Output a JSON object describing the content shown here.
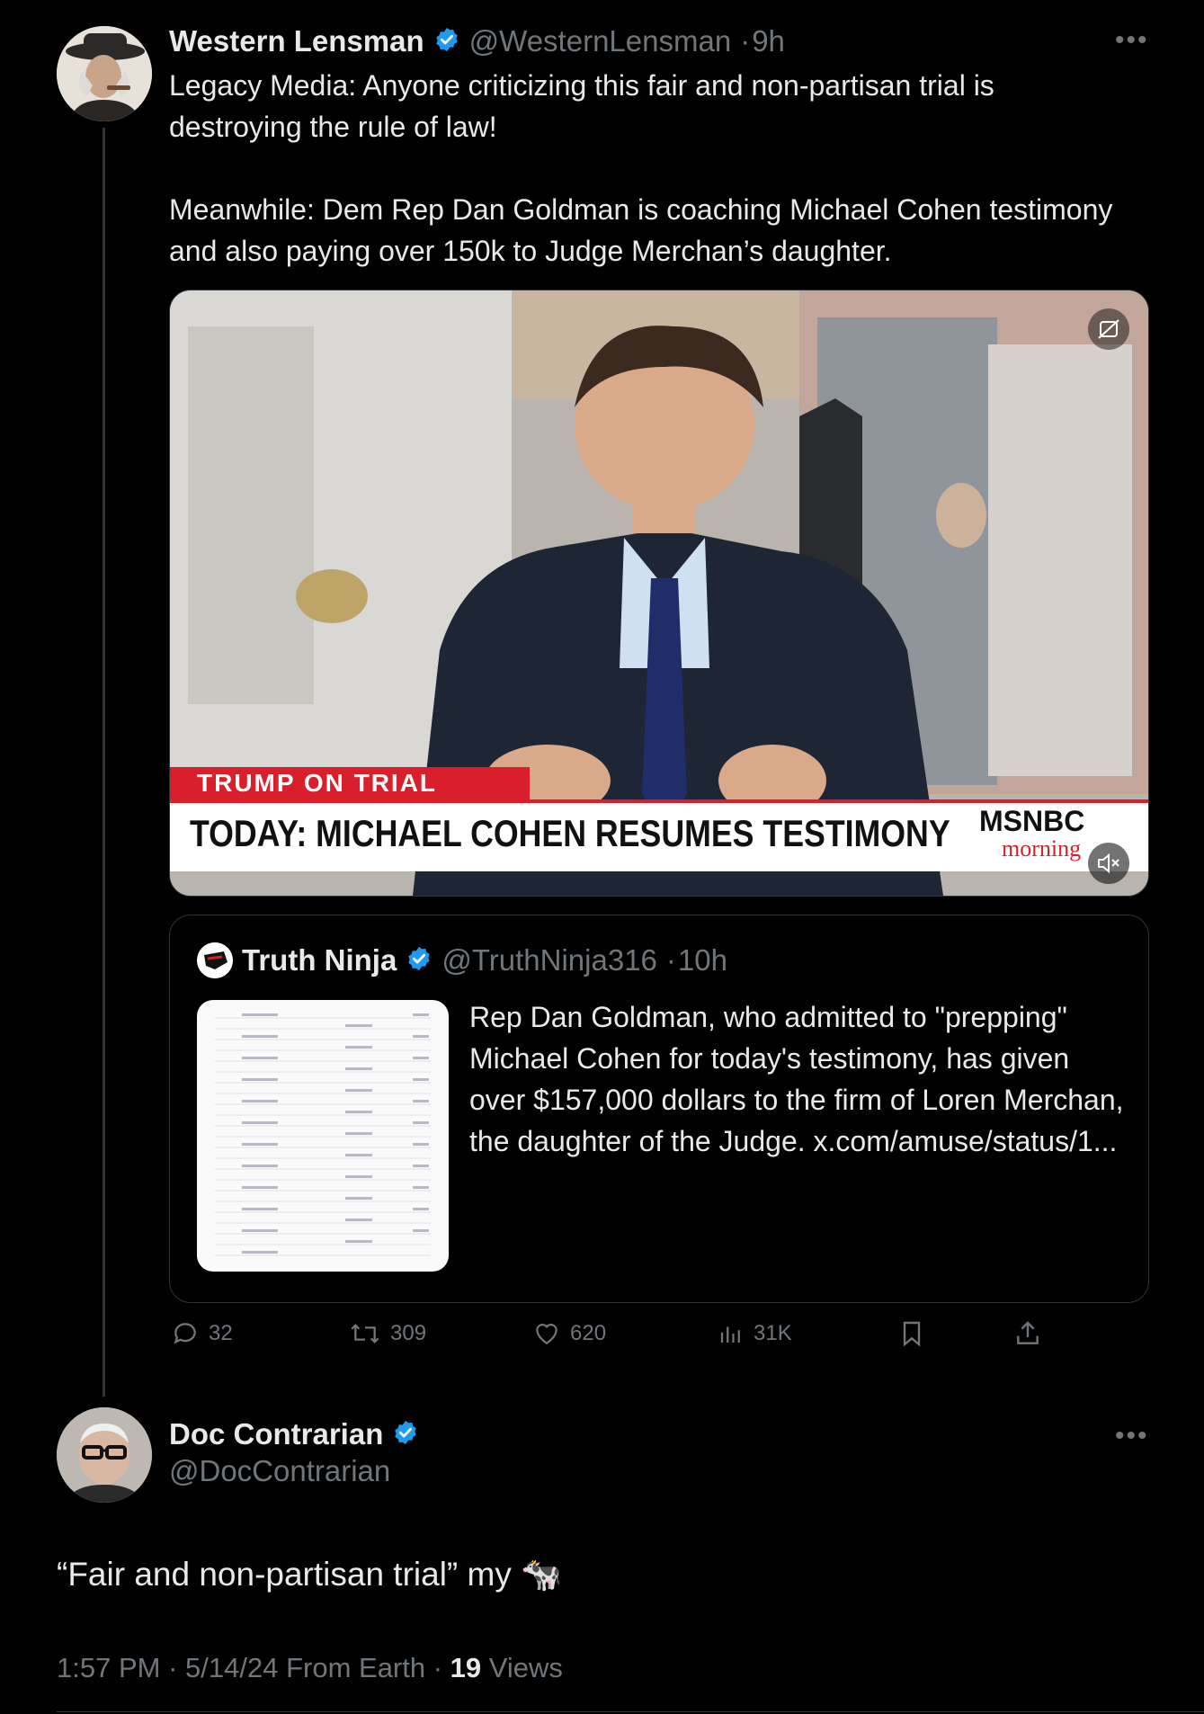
{
  "tweet": {
    "author_name": "Western Lensman",
    "handle": "@WesternLensman",
    "time": "9h",
    "text": "Legacy Media: Anyone criticizing this fair and non-partisan trial is destroying the rule of law!\n\nMeanwhile: Dem Rep Dan Goldman is coaching Michael Cohen testimony and also paying over 150k to Judge Merchan’s daughter.",
    "video": {
      "banner_tag": "TRUMP ON TRIAL",
      "headline": "TODAY: MICHAEL COHEN RESUMES TESTIMONY",
      "network": "MSNBC",
      "show": "morning"
    },
    "quote": {
      "author_name": "Truth Ninja",
      "handle": "@TruthNinja316",
      "time": "10h",
      "text": "Rep Dan Goldman, who admitted to \"prepping\" Michael Cohen for today's testimony, has given over $157,000 dollars to the firm of Loren Merchan, the daughter of the Judge. x.com/amuse/status/1..."
    },
    "actions": {
      "replies": "32",
      "reposts": "309",
      "likes": "620",
      "views": "31K"
    }
  },
  "reply": {
    "author_name": "Doc Contrarian",
    "handle": "@DocContrarian",
    "text": "“Fair and non-partisan trial” my 🐄",
    "footer": {
      "time": "1:57 PM",
      "date": "5/14/24",
      "source": "From Earth",
      "views_count": "19",
      "views_label": "Views"
    }
  },
  "colors": {
    "accent": "#1d9bf0",
    "text": "#e7e9ea",
    "muted": "#71767b",
    "msnbc_red": "#d91f2b"
  }
}
